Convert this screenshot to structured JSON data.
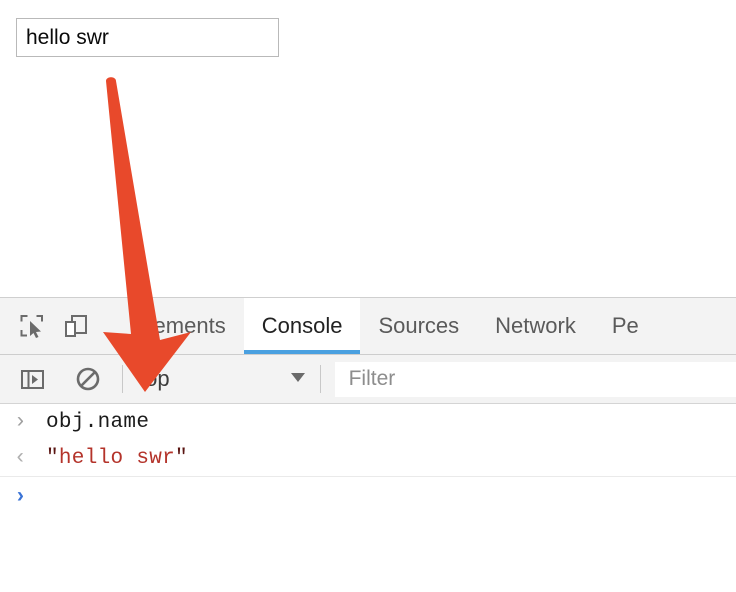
{
  "page": {
    "input": {
      "value": "hello swr",
      "placeholder": ""
    }
  },
  "annotation": {
    "arrow_color": "#e8492b",
    "name": "orange-down-arrow"
  },
  "devtools": {
    "toolbar": {
      "inspect_icon": "inspect-element-icon",
      "device_icon": "device-toolbar-icon",
      "tabs": [
        {
          "label": "Elements",
          "active": false
        },
        {
          "label": "Console",
          "active": true
        },
        {
          "label": "Sources",
          "active": false
        },
        {
          "label": "Network",
          "active": false
        },
        {
          "label": "Pe",
          "active": false
        }
      ],
      "active_tab_color": "#4aa0e0"
    },
    "filterbar": {
      "sidebar_icon": "console-sidebar-toggle-icon",
      "clear_icon": "clear-console-icon",
      "context": "top",
      "caret": "▼",
      "filter_placeholder": "Filter",
      "filter_value": ""
    },
    "console": {
      "rows": [
        {
          "type": "input",
          "prompt": "›",
          "text": "obj.name"
        },
        {
          "type": "output",
          "prompt": "‹",
          "quote": "\"",
          "value": "hello swr"
        }
      ],
      "active_prompt": "›",
      "string_color": "#b4332a"
    }
  }
}
